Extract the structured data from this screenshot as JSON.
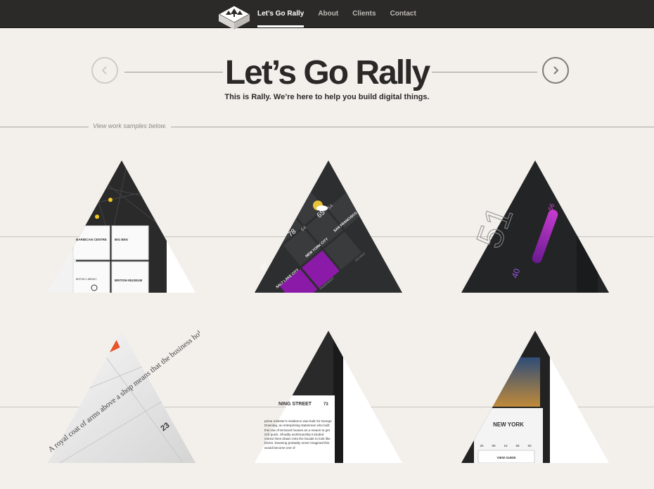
{
  "nav": {
    "logo_name": "rally-logo",
    "items": [
      {
        "label": "Let’s Go Rally",
        "active": true
      },
      {
        "label": "About",
        "active": false
      },
      {
        "label": "Clients",
        "active": false
      },
      {
        "label": "Contact",
        "active": false
      }
    ]
  },
  "hero": {
    "title": "Let’s Go Rally",
    "subtitle": "This is Rally. We’re here to help you build digital things.",
    "prev_icon": "chevron-left-icon",
    "next_icon": "chevron-right-icon"
  },
  "samples_section": {
    "label": "View work samples below."
  },
  "samples": [
    {
      "name": "sample-london-map-app",
      "texts": [
        "BARBICAN CENTRE",
        "BIG BEN",
        "BRITISH MUSEUM",
        "BRITISH LIBRARY"
      ]
    },
    {
      "name": "sample-weather-app",
      "texts": [
        "65",
        "54",
        "SAN FRANCISCO",
        "78",
        "64",
        "NEW YORK CITY",
        "67",
        "SALT LAKE CITY",
        "CELSIUS",
        "FAHRENHEIT"
      ]
    },
    {
      "name": "sample-thermostat-app",
      "texts": [
        "51",
        "56",
        "40"
      ]
    },
    {
      "name": "sample-coat-of-arms-app",
      "texts": [
        "A royal coat of arms above a shop means that the business holds a royal warrant to supply the sovereign.",
        "23"
      ]
    },
    {
      "name": "sample-downing-street-app",
      "texts": [
        "NING STREET",
        "73",
        "prime minister's residence was built Sir George Downing, an enterprising statesman who built this row of terraced houses as a means to get rich quick. Shoddy workmanship included mortar lines drawn onto the facade to look like bricks. Downing probably never imagined this would become one of"
      ]
    },
    {
      "name": "sample-city-guide-app",
      "texts": [
        "NEW YORK",
        "25",
        "69",
        "15",
        "58",
        "50",
        "VIEW GUIDE"
      ]
    }
  ],
  "colors": {
    "topbar": "#2b2a28",
    "background": "#f3f0ec",
    "accent_purple": "#8c1aa8",
    "accent_orange": "#e8542a"
  }
}
